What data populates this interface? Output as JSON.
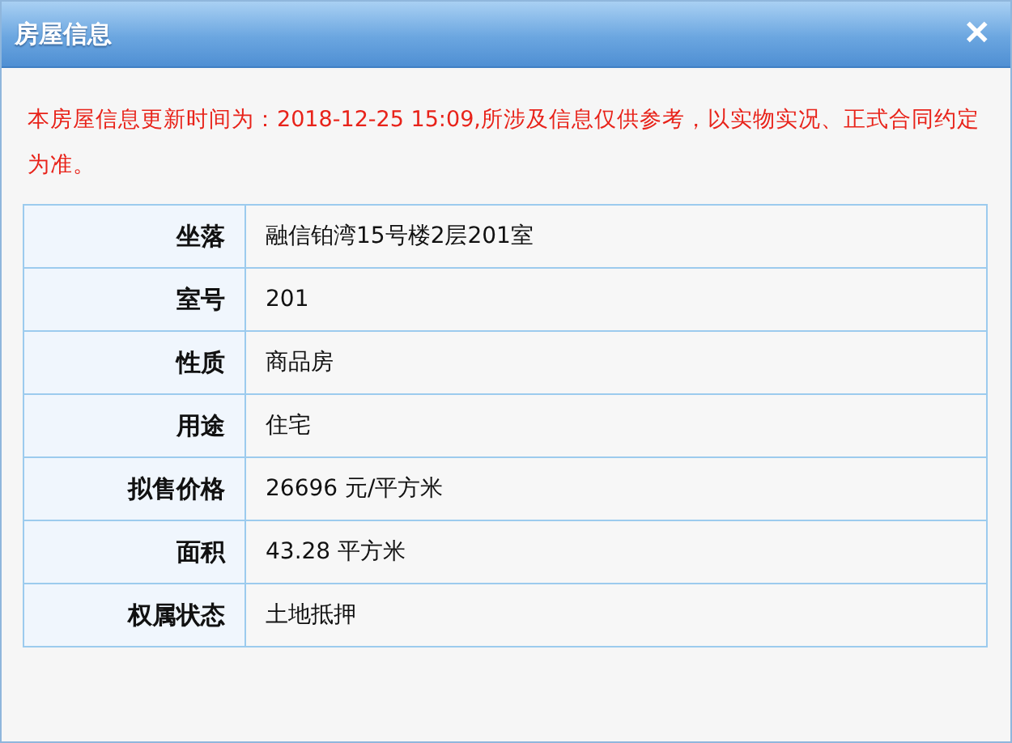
{
  "window": {
    "title": "房屋信息",
    "close": "✕"
  },
  "notice": "本房屋信息更新时间为：2018-12-25 15:09,所涉及信息仅供参考，以实物实况、正式合同约定为准。",
  "table": {
    "rows": [
      {
        "label": "坐落",
        "value": "融信铂湾15号楼2层201室"
      },
      {
        "label": "室号",
        "value": "201"
      },
      {
        "label": "性质",
        "value": "商品房"
      },
      {
        "label": "用途",
        "value": "住宅"
      },
      {
        "label": "拟售价格",
        "value": "26696 元/平方米"
      },
      {
        "label": "面积",
        "value": "43.28 平方米"
      },
      {
        "label": "权属状态",
        "value": "土地抵押"
      }
    ]
  }
}
